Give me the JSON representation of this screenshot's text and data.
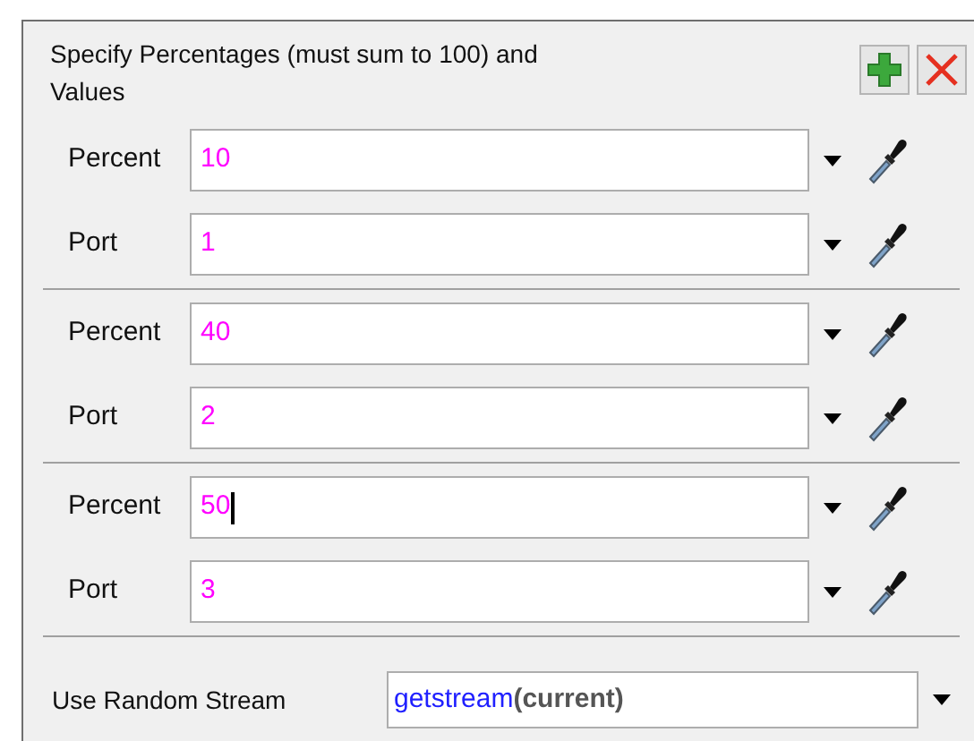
{
  "panel": {
    "title": "Specify Percentages (must sum to 100) and Values"
  },
  "groups": [
    {
      "percent": {
        "label": "Percent",
        "value": "10",
        "focused": false
      },
      "port": {
        "label": "Port",
        "value": "1",
        "focused": false
      }
    },
    {
      "percent": {
        "label": "Percent",
        "value": "40",
        "focused": false
      },
      "port": {
        "label": "Port",
        "value": "2",
        "focused": false
      }
    },
    {
      "percent": {
        "label": "Percent",
        "value": "50",
        "focused": true
      },
      "port": {
        "label": "Port",
        "value": "3",
        "focused": false
      }
    }
  ],
  "stream": {
    "label": "Use Random Stream",
    "function": "getstream",
    "argument": "(current)"
  }
}
